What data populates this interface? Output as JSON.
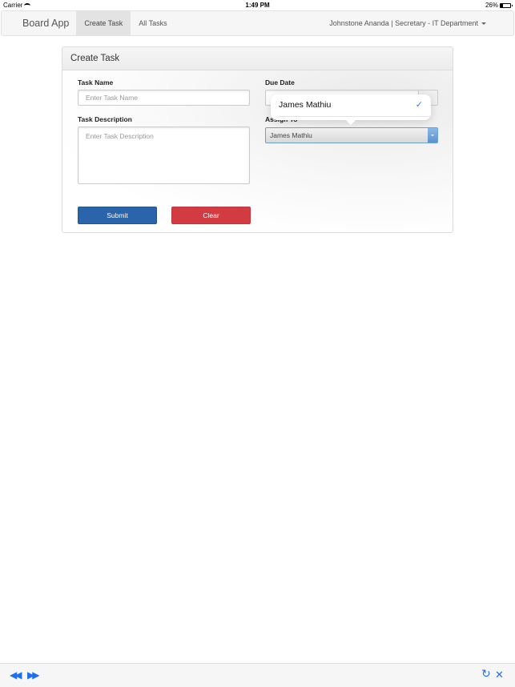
{
  "status_bar": {
    "carrier": "Carrier",
    "time": "1:49 PM",
    "battery": "26%",
    "battery_level": 0.26
  },
  "navbar": {
    "brand": "Board App",
    "tabs": [
      {
        "label": "Create Task",
        "active": true
      },
      {
        "label": "All Tasks",
        "active": false
      }
    ],
    "user_menu": "Johnstone Ananda | Secretary - IT Department"
  },
  "panel": {
    "title": "Create Task",
    "task_name": {
      "label": "Task Name",
      "placeholder": "Enter Task Name",
      "value": ""
    },
    "task_description": {
      "label": "Task Description",
      "placeholder": "Enter Task Description",
      "value": ""
    },
    "due_date": {
      "label": "Due Date",
      "value": ""
    },
    "assign_to": {
      "label": "Assign To",
      "value": "James Mathiu"
    },
    "submit_label": "Submit",
    "clear_label": "Clear"
  },
  "picker_popover": {
    "options": [
      {
        "label": "James Mathiu",
        "selected": true
      }
    ],
    "check_glyph": "✓"
  },
  "bottom_toolbar": {
    "back_icon": "◀◀",
    "forward_icon": "▶▶",
    "reload_icon": "↻",
    "close_icon": "✕"
  },
  "colors": {
    "primary": "#2a64aa",
    "danger": "#d13b41",
    "ios_blue": "#1e6ef2"
  }
}
